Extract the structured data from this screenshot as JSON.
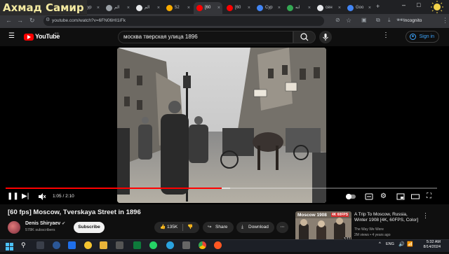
{
  "overlay_name": "Ахмад Самир",
  "tabs": [
    {
      "label": "Сур",
      "color": "#4285f4"
    },
    {
      "label": "الم",
      "color": "#9aa0a6"
    },
    {
      "label": "الم",
      "color": "#e8eaed"
    },
    {
      "label": "52",
      "color": "#f9ab00"
    },
    {
      "label": "[60",
      "color": "#ff0000",
      "active": true
    },
    {
      "label": "[60",
      "color": "#ff0000"
    },
    {
      "label": "Сур",
      "color": "#4285f4"
    },
    {
      "label": "ابه",
      "color": "#34a853"
    },
    {
      "label": "сен",
      "color": "#e8eaed"
    },
    {
      "label": "Goo",
      "color": "#4285f4"
    }
  ],
  "browser": {
    "url": "youtube.com/watch?v=6FN06HI1iFk",
    "profile": "Incognito"
  },
  "youtube": {
    "logo_text": "YouTube",
    "region": "EG",
    "search_query": "москва тверская улица 1896",
    "sign_in": "Sign in"
  },
  "player": {
    "current_time": "1:05",
    "duration": "2:10",
    "progress": 0.5
  },
  "video": {
    "title": "[60 fps] Moscow, Tverskaya Street in 1896",
    "channel": "Denis Shiryaev",
    "subscribers": "578K subscribers",
    "subscribe_label": "Subscribe",
    "likes": "135K",
    "share_label": "Share",
    "download_label": "Download"
  },
  "suggestion": {
    "thumb_caption": "Moscow 1908",
    "thumb_badge": "4K 60FPS",
    "duration": "5:11",
    "title": "A Trip To Moscow, Russia, Winter 1908 [4K, 60FPS, Color]",
    "channel": "The Way We Were",
    "meta": "2M views • 4 years ago"
  },
  "taskbar": {
    "time": "5:32 AM",
    "date": "8/14/2024",
    "lang": "ENG"
  }
}
